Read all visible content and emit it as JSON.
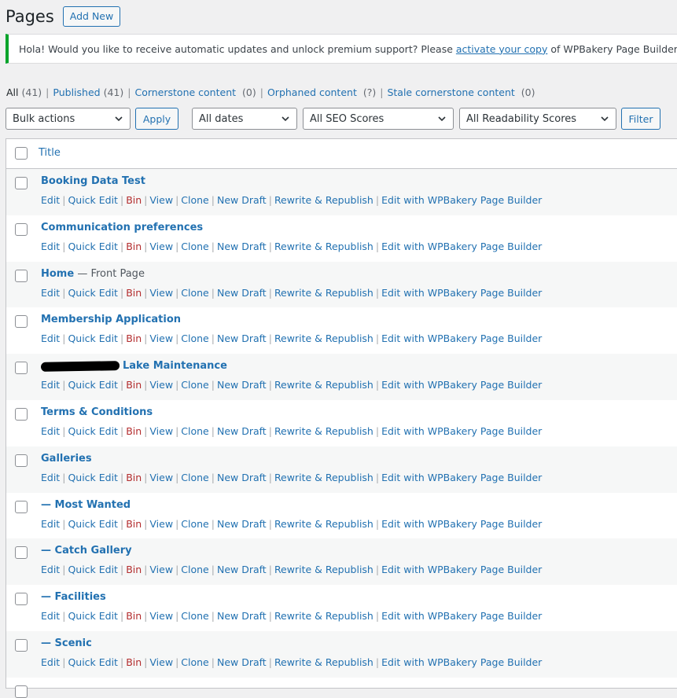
{
  "header": {
    "title": "Pages",
    "add_new_label": "Add New"
  },
  "notice": {
    "text_before": "Hola! Would you like to receive automatic updates and unlock premium support? Please ",
    "link_text": "activate your copy",
    "text_after": " of WPBakery Page Builder."
  },
  "views": [
    {
      "label": "All",
      "count": "(41)"
    },
    {
      "label": "Published",
      "count": "(41)"
    },
    {
      "label": "Cornerstone content",
      "count": "(0)"
    },
    {
      "label": "Orphaned content",
      "count": "(?)"
    },
    {
      "label": "Stale cornerstone content",
      "count": "(0)"
    }
  ],
  "filters": {
    "bulk_actions": "Bulk actions",
    "apply_label": "Apply",
    "dates": "All dates",
    "seo": "All SEO Scores",
    "readability": "All Readability Scores",
    "filter_label": "Filter"
  },
  "table": {
    "title_header": "Title",
    "row_actions": [
      "Edit",
      "Quick Edit",
      "Bin",
      "View",
      "Clone",
      "New Draft",
      "Rewrite & Republish",
      "Edit with WPBakery Page Builder"
    ],
    "rows": [
      {
        "title": "Booking Data Test",
        "state": ""
      },
      {
        "title": "Communication preferences",
        "state": ""
      },
      {
        "title": "Home",
        "state": " — Front Page"
      },
      {
        "title": "Membership Application",
        "state": ""
      },
      {
        "title": "Lake Maintenance",
        "state": ""
      },
      {
        "title": "Terms & Conditions",
        "state": ""
      },
      {
        "title": "Galleries",
        "state": ""
      },
      {
        "title": "— Most Wanted",
        "state": ""
      },
      {
        "title": "— Catch Gallery",
        "state": ""
      },
      {
        "title": "— Facilities",
        "state": ""
      },
      {
        "title": "— Scenic",
        "state": ""
      }
    ]
  }
}
